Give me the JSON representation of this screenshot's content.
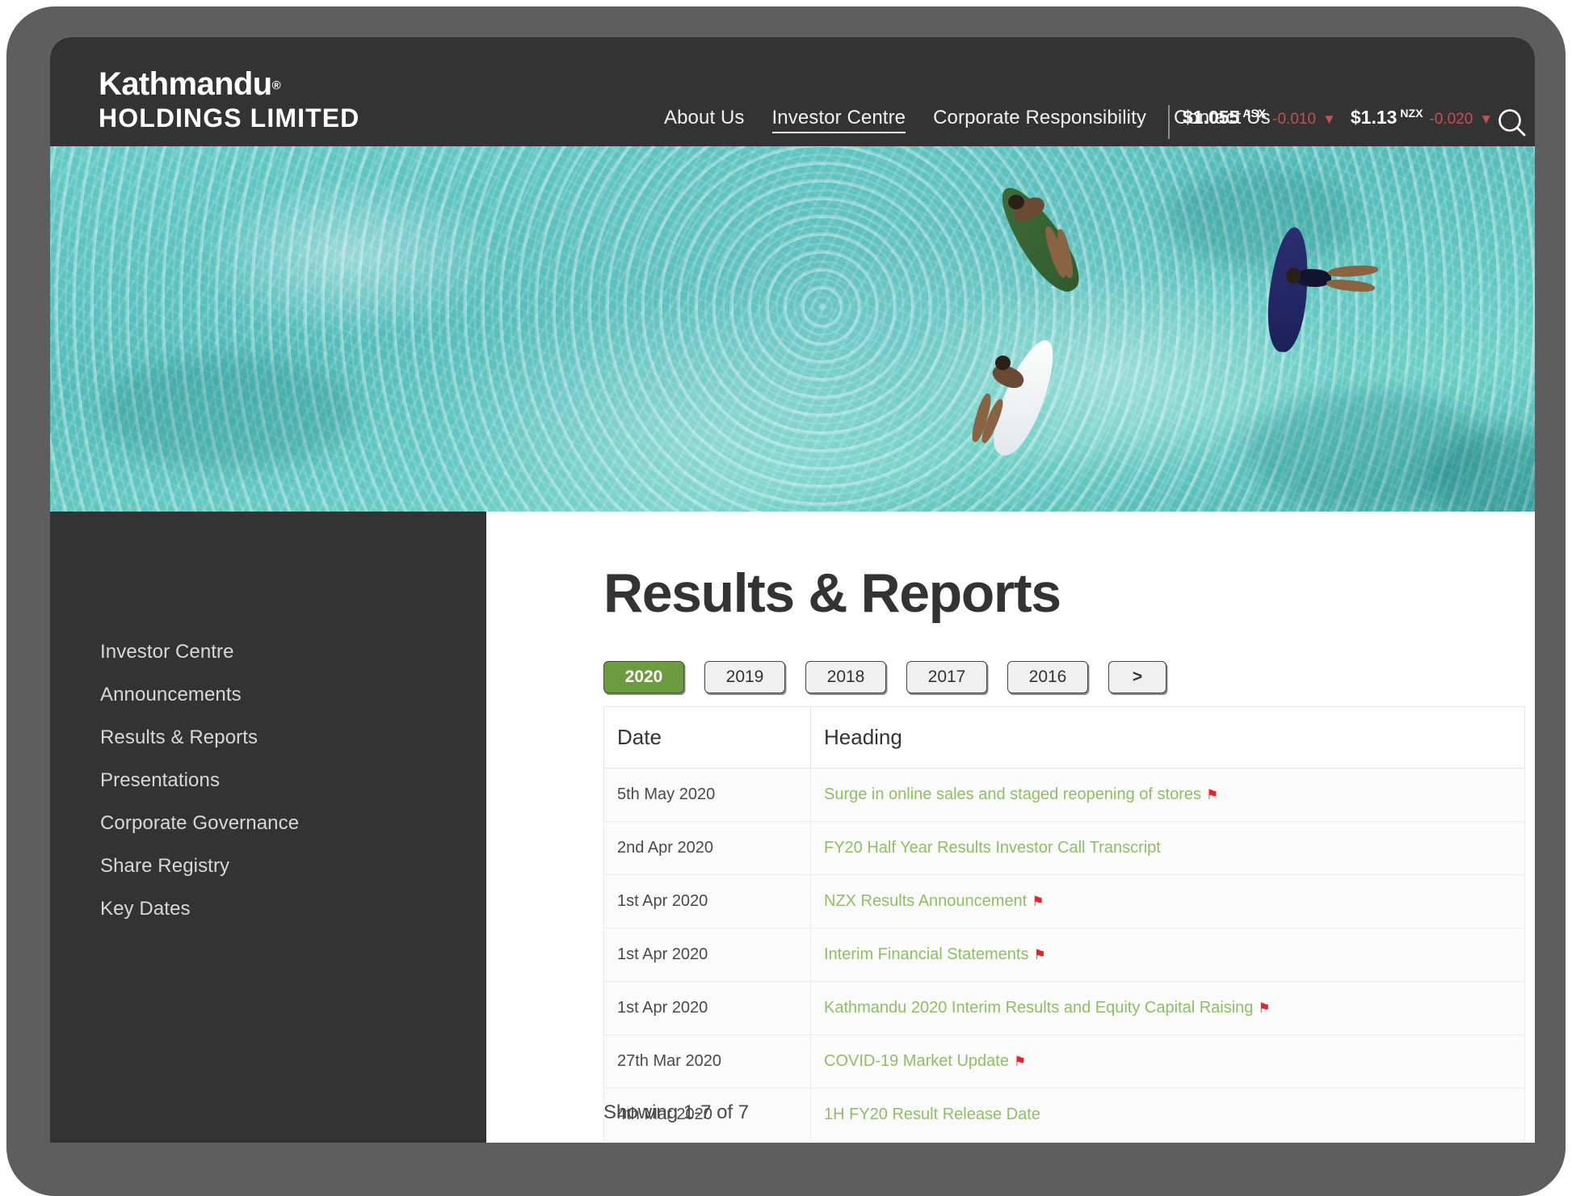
{
  "header": {
    "brand": {
      "line1": "Kathmandu",
      "registered_mark": "®",
      "line2": "HOLDINGS LIMITED"
    },
    "nav": [
      {
        "label": "About Us",
        "active": false
      },
      {
        "label": "Investor Centre",
        "active": true
      },
      {
        "label": "Corporate Responsibility",
        "active": false
      },
      {
        "label": "Contact Us",
        "active": false
      }
    ],
    "tickers": [
      {
        "price": "$1.055",
        "market": "ASX",
        "change": "-0.010",
        "arrow": "▼",
        "direction": "down",
        "change_color": "#c4504f"
      },
      {
        "price": "$1.13",
        "market": "NZX",
        "change": "-0.020",
        "arrow": "▼",
        "direction": "down",
        "change_color": "#c4504f"
      }
    ],
    "search_icon": "search-icon",
    "background_color": "#333333"
  },
  "hero": {
    "alt": "aerial-view-of-three-surfers-floating-on-boards-in-turquoise-water",
    "water_color": "#58c2c0"
  },
  "sidebar": {
    "background_color": "#333333",
    "items": [
      {
        "label": "Investor Centre"
      },
      {
        "label": "Announcements"
      },
      {
        "label": "Results & Reports"
      },
      {
        "label": "Presentations"
      },
      {
        "label": "Corporate Governance"
      },
      {
        "label": "Share Registry"
      },
      {
        "label": "Key Dates"
      }
    ]
  },
  "main": {
    "title": "Results & Reports",
    "year_filter": {
      "active_year": "2020",
      "buttons": [
        {
          "label": "2020",
          "active": true
        },
        {
          "label": "2019",
          "active": false
        },
        {
          "label": "2018",
          "active": false
        },
        {
          "label": "2017",
          "active": false
        },
        {
          "label": "2016",
          "active": false
        },
        {
          "label": ">",
          "active": false,
          "next": true
        }
      ],
      "active_color": "#6d9b40"
    },
    "table": {
      "columns": [
        "Date",
        "Heading"
      ],
      "link_color": "#8cc063",
      "flag_color": "#e8242a",
      "rows": [
        {
          "date": "5th May 2020",
          "heading": "Surge in online sales and staged reopening of stores",
          "flag": true
        },
        {
          "date": "2nd Apr 2020",
          "heading": "FY20 Half Year Results Investor Call Transcript",
          "flag": false
        },
        {
          "date": "1st Apr 2020",
          "heading": "NZX Results Announcement",
          "flag": true
        },
        {
          "date": "1st Apr 2020",
          "heading": "Interim Financial Statements",
          "flag": true
        },
        {
          "date": "1st Apr 2020",
          "heading": "Kathmandu 2020 Interim Results and Equity Capital Raising",
          "flag": true
        },
        {
          "date": "27th Mar 2020",
          "heading": "COVID-19 Market Update",
          "flag": true
        },
        {
          "date": "4th Mar 2020",
          "heading": "1H FY20 Result Release Date",
          "flag": false
        }
      ]
    },
    "showing_count": "Showing 1-7 of 7"
  }
}
